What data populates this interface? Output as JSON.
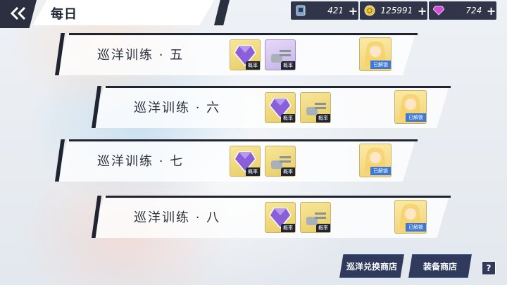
{
  "header": {
    "back_icon": "double-chevron-left-icon",
    "title": "每日"
  },
  "resources": [
    {
      "icon": "oil-card-icon",
      "value": "421",
      "plus": "+"
    },
    {
      "icon": "gold-coin-icon",
      "value": "125991",
      "plus": "+"
    },
    {
      "icon": "purple-gem-icon",
      "value": "724",
      "plus": "+"
    }
  ],
  "stages": [
    {
      "name": "巡洋训练 · 五",
      "rewards": [
        {
          "icon": "gem-icon",
          "tag": "概率"
        },
        {
          "icon": "gun-turret-icon",
          "tag": "概率",
          "rarity": "purple"
        }
      ],
      "unlock_label": "已解锁"
    },
    {
      "name": "巡洋训练 · 六",
      "rewards": [
        {
          "icon": "gem-icon",
          "tag": "概率"
        },
        {
          "icon": "gun-turret-icon",
          "tag": "概率"
        }
      ],
      "unlock_label": "已解锁"
    },
    {
      "name": "巡洋训练 · 七",
      "rewards": [
        {
          "icon": "gem-icon",
          "tag": "概率"
        },
        {
          "icon": "gun-turret-icon",
          "tag": "概率"
        }
      ],
      "unlock_label": "已解锁"
    },
    {
      "name": "巡洋训练 · 八",
      "rewards": [
        {
          "icon": "gem-icon",
          "tag": "概率"
        },
        {
          "icon": "gun-turret-icon",
          "tag": "概率"
        }
      ],
      "unlock_label": "已解锁"
    }
  ],
  "footer": {
    "exchange_shop": "巡洋兑换商店",
    "equipment_shop": "装备商店",
    "help": "?"
  },
  "colors": {
    "accent": "#2b3040",
    "gold": "#f1d379",
    "unlock_blue": "#3d78d8"
  }
}
